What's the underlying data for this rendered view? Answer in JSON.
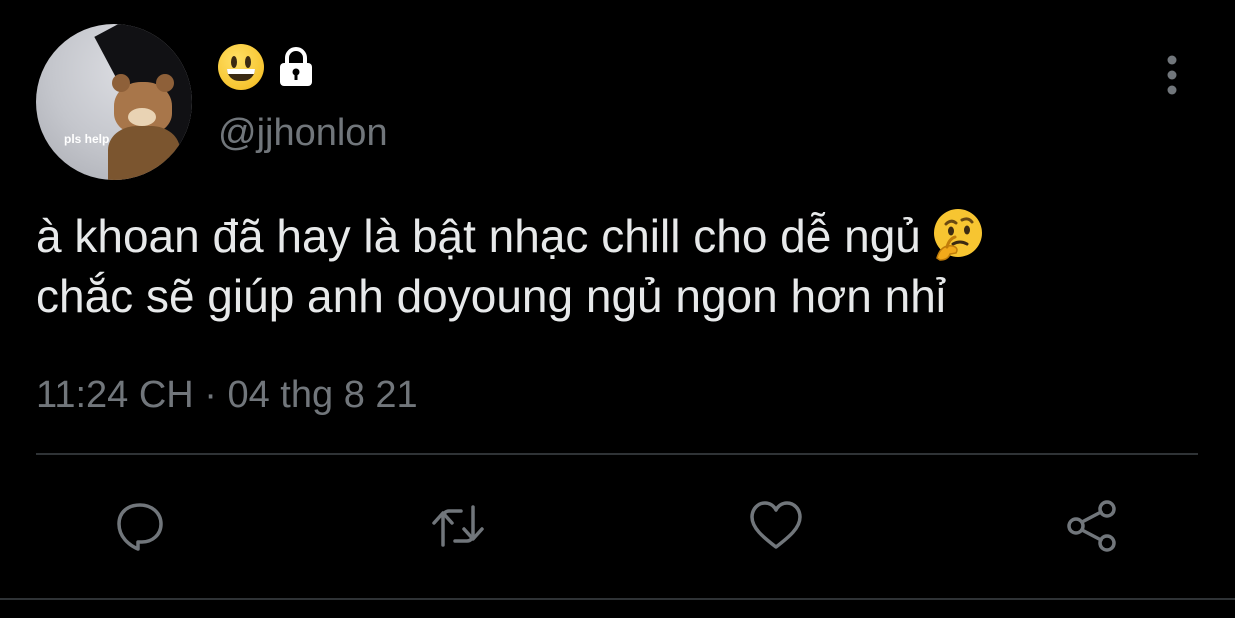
{
  "author": {
    "avatar_caption": "pls help",
    "display_name_icons": [
      "grinning-face-emoji",
      "lock-icon"
    ],
    "handle": "@jjhonlon"
  },
  "tweet": {
    "line1": "à khoan đã hay là bật nhạc chill cho dễ ngủ",
    "line1_emoji": "thinking-face-emoji",
    "line2": "chắc sẽ giúp anh doyoung ngủ ngon hơn nhỉ",
    "timestamp": "11:24 CH · 04 thg 8 21"
  },
  "actions": [
    {
      "name": "reply",
      "icon": "reply-icon"
    },
    {
      "name": "retweet",
      "icon": "retweet-icon"
    },
    {
      "name": "like",
      "icon": "heart-icon"
    },
    {
      "name": "share",
      "icon": "share-icon"
    }
  ],
  "colors": {
    "background": "#000000",
    "text": "#e7e9ea",
    "secondary": "#71767b",
    "divider": "#2f3336"
  }
}
